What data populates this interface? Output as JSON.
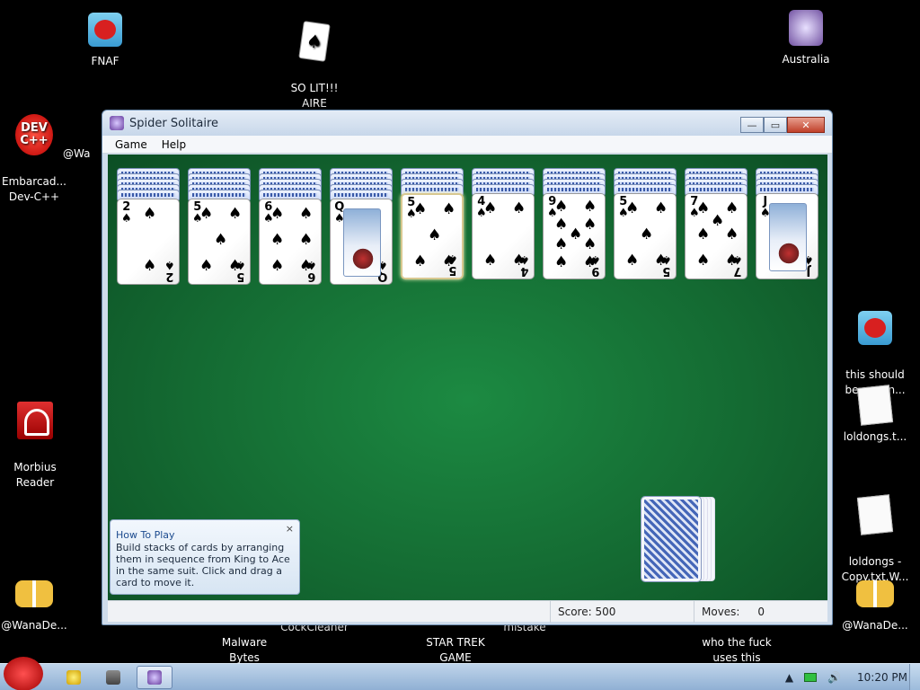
{
  "desktop": {
    "icons": [
      {
        "label": "FNAF",
        "icon": "angry-bird-icon"
      },
      {
        "label": "SO LIT!!!\nAIRE",
        "icon": "card-icon"
      },
      {
        "label": "Australia",
        "icon": "spider-solitaire-icon"
      },
      {
        "label": "Embarcad...\nDev-C++",
        "icon": "dev-cpp-icon"
      },
      {
        "label": "@Wa",
        "icon": "shortcut-icon"
      },
      {
        "label": "this should\nbe on vin...",
        "icon": "angry-bird-icon"
      },
      {
        "label": "Morbius\nReader",
        "icon": "pdf-reader-icon"
      },
      {
        "label": "loldongs.t...",
        "icon": "text-file-icon"
      },
      {
        "label": "loldongs -\nCopy.txt.W...",
        "icon": "text-file-icon"
      },
      {
        "label": "@WanaDe...",
        "icon": "handshake-icon"
      },
      {
        "label": "@WanaDe...",
        "icon": "handshake-icon"
      },
      {
        "label": "Malware\nBytes",
        "icon": "malwarebytes-icon"
      },
      {
        "label": "CockCleaner",
        "icon": "cleaner-icon"
      },
      {
        "label": "STAR TREK\nGAME",
        "icon": "game-icon"
      },
      {
        "label": "mistake",
        "icon": "file-icon"
      },
      {
        "label": "who the fuck\nuses this",
        "icon": "file-icon"
      }
    ],
    "devcpp_text": "DEV\nC++"
  },
  "window": {
    "title": "Spider Solitaire",
    "minimize": "—",
    "maximize": "▭",
    "close": "✕",
    "menu": [
      "Game",
      "Help"
    ]
  },
  "game": {
    "suit": "♠",
    "piles": [
      {
        "hidden": 5,
        "rank": "2"
      },
      {
        "hidden": 5,
        "rank": "5"
      },
      {
        "hidden": 5,
        "rank": "6"
      },
      {
        "hidden": 5,
        "rank": "Q"
      },
      {
        "hidden": 4,
        "rank": "5",
        "selected": true
      },
      {
        "hidden": 4,
        "rank": "4"
      },
      {
        "hidden": 4,
        "rank": "9"
      },
      {
        "hidden": 4,
        "rank": "5"
      },
      {
        "hidden": 4,
        "rank": "7"
      },
      {
        "hidden": 4,
        "rank": "J"
      }
    ],
    "stock_deals": 5,
    "score_label": "Score:",
    "score": "500",
    "moves_label": "Moves:",
    "moves": "0"
  },
  "howto": {
    "title": "How To Play",
    "text": "Build stacks of cards by arranging them in sequence from King to Ace in the same suit. Click and drag a card to move it.",
    "close": "×"
  },
  "taskbar": {
    "time": "10:20 PM",
    "volume": "🔊",
    "tray_arrow": "▲"
  }
}
